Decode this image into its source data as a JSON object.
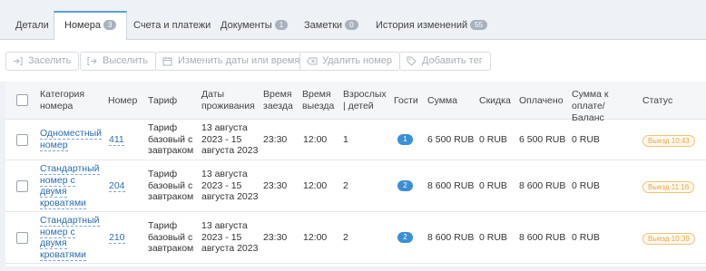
{
  "tabs": [
    {
      "label": "Детали",
      "badge": ""
    },
    {
      "label": "Номера",
      "badge": "3"
    },
    {
      "label": "Счета и платежи",
      "badge": ""
    },
    {
      "label": "Документы",
      "badge": "1"
    },
    {
      "label": "Заметки",
      "badge": "0"
    },
    {
      "label": "История изменений",
      "badge": "55"
    }
  ],
  "toolbar": {
    "checkin": "Заселить",
    "checkout": "Выселить",
    "change_dates": "Изменить даты или время",
    "delete_room": "Удалить номер",
    "add_tag": "Добавить тег"
  },
  "columns": {
    "category": "Категория номера",
    "room": "Номер",
    "tariff": "Тариф",
    "dates": "Даты проживания",
    "checkin_time": "Время заезда",
    "checkout_time": "Время выезда",
    "adults_children": "Взрослых | детей",
    "guests": "Гости",
    "sum": "Сумма",
    "discount": "Скидка",
    "paid": "Оплачено",
    "to_pay": "Сумма к оплате/Баланс",
    "status": "Статус"
  },
  "rows": [
    {
      "category": "Одноместный номер",
      "room": "411",
      "tariff": "Тариф базовый с завтраком",
      "dates": "13 августа 2023 - 15 августа 2023",
      "checkin_time": "23:30",
      "checkout_time": "12:00",
      "adults": "1",
      "guests": "1",
      "sum": "6 500 RUB",
      "discount": "0 RUB",
      "paid": "6 500 RUB",
      "to_pay": "0 RUB",
      "status": "Выезд 10:43"
    },
    {
      "category": "Стандартный номер с двумя кроватями",
      "room": "204",
      "tariff": "Тариф базовый с завтраком",
      "dates": "13 августа 2023 - 15 августа 2023",
      "checkin_time": "23:30",
      "checkout_time": "12:00",
      "adults": "2",
      "guests": "2",
      "sum": "8 600 RUB",
      "discount": "0 RUB",
      "paid": "8 600 RUB",
      "to_pay": "0 RUB",
      "status": "Выезд 11:16"
    },
    {
      "category": "Стандартный номер с двумя кроватями",
      "room": "210",
      "tariff": "Тариф базовый с завтраком",
      "dates": "13 августа 2023 - 15 августа 2023",
      "checkin_time": "23:30",
      "checkout_time": "12:00",
      "adults": "2",
      "guests": "2",
      "sum": "8 600 RUB",
      "discount": "0 RUB",
      "paid": "8 600 RUB",
      "to_pay": "0 RUB",
      "status": "Выезд 10:39"
    }
  ]
}
